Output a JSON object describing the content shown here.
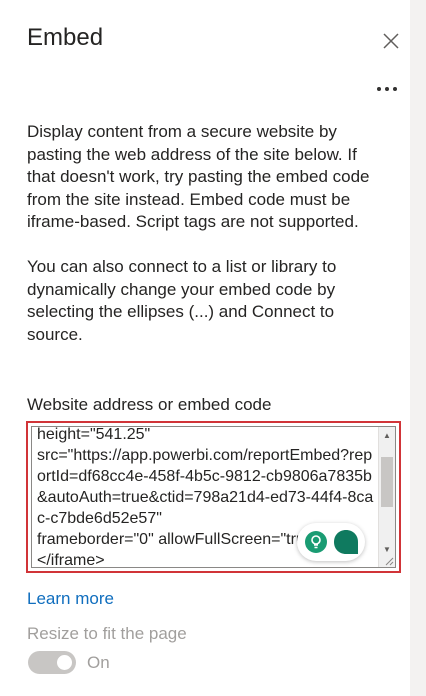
{
  "panel": {
    "title": "Embed",
    "close_icon": "close-icon",
    "more_icon": "more-options-icon"
  },
  "description": {
    "paragraph1": "Display content from a secure website by pasting the web address of the site below. If that doesn't work, try pasting the embed code from the site instead. Embed code must be iframe-based. Script tags are not supported.",
    "paragraph2": "You can also connect to a list or library to dynamically change your embed code by selecting the ellipses (...) and Connect to source."
  },
  "embed_field": {
    "label": "Website address or embed code",
    "value": "height=\"541.25\"\nsrc=\"https://app.powerbi.com/reportEmbed?reportId=df68cc4e-458f-4b5c-9812-cb9806a7835b&autoAuth=true&ctid=798a21d4-ed73-44f4-8cac-c7bde6d52e57\"\nframeborder=\"0\" allowFullScreen=\"true\">\n</iframe>",
    "highlight_color": "#d13438"
  },
  "learn_more": "Learn more",
  "resize": {
    "label": "Resize to fit the page",
    "state_label": "On",
    "enabled": true,
    "disabled_appearance": true
  },
  "colors": {
    "link": "#106ebe",
    "disabled_text": "#a19f9d",
    "assistant_accent": "#1a9c73"
  }
}
